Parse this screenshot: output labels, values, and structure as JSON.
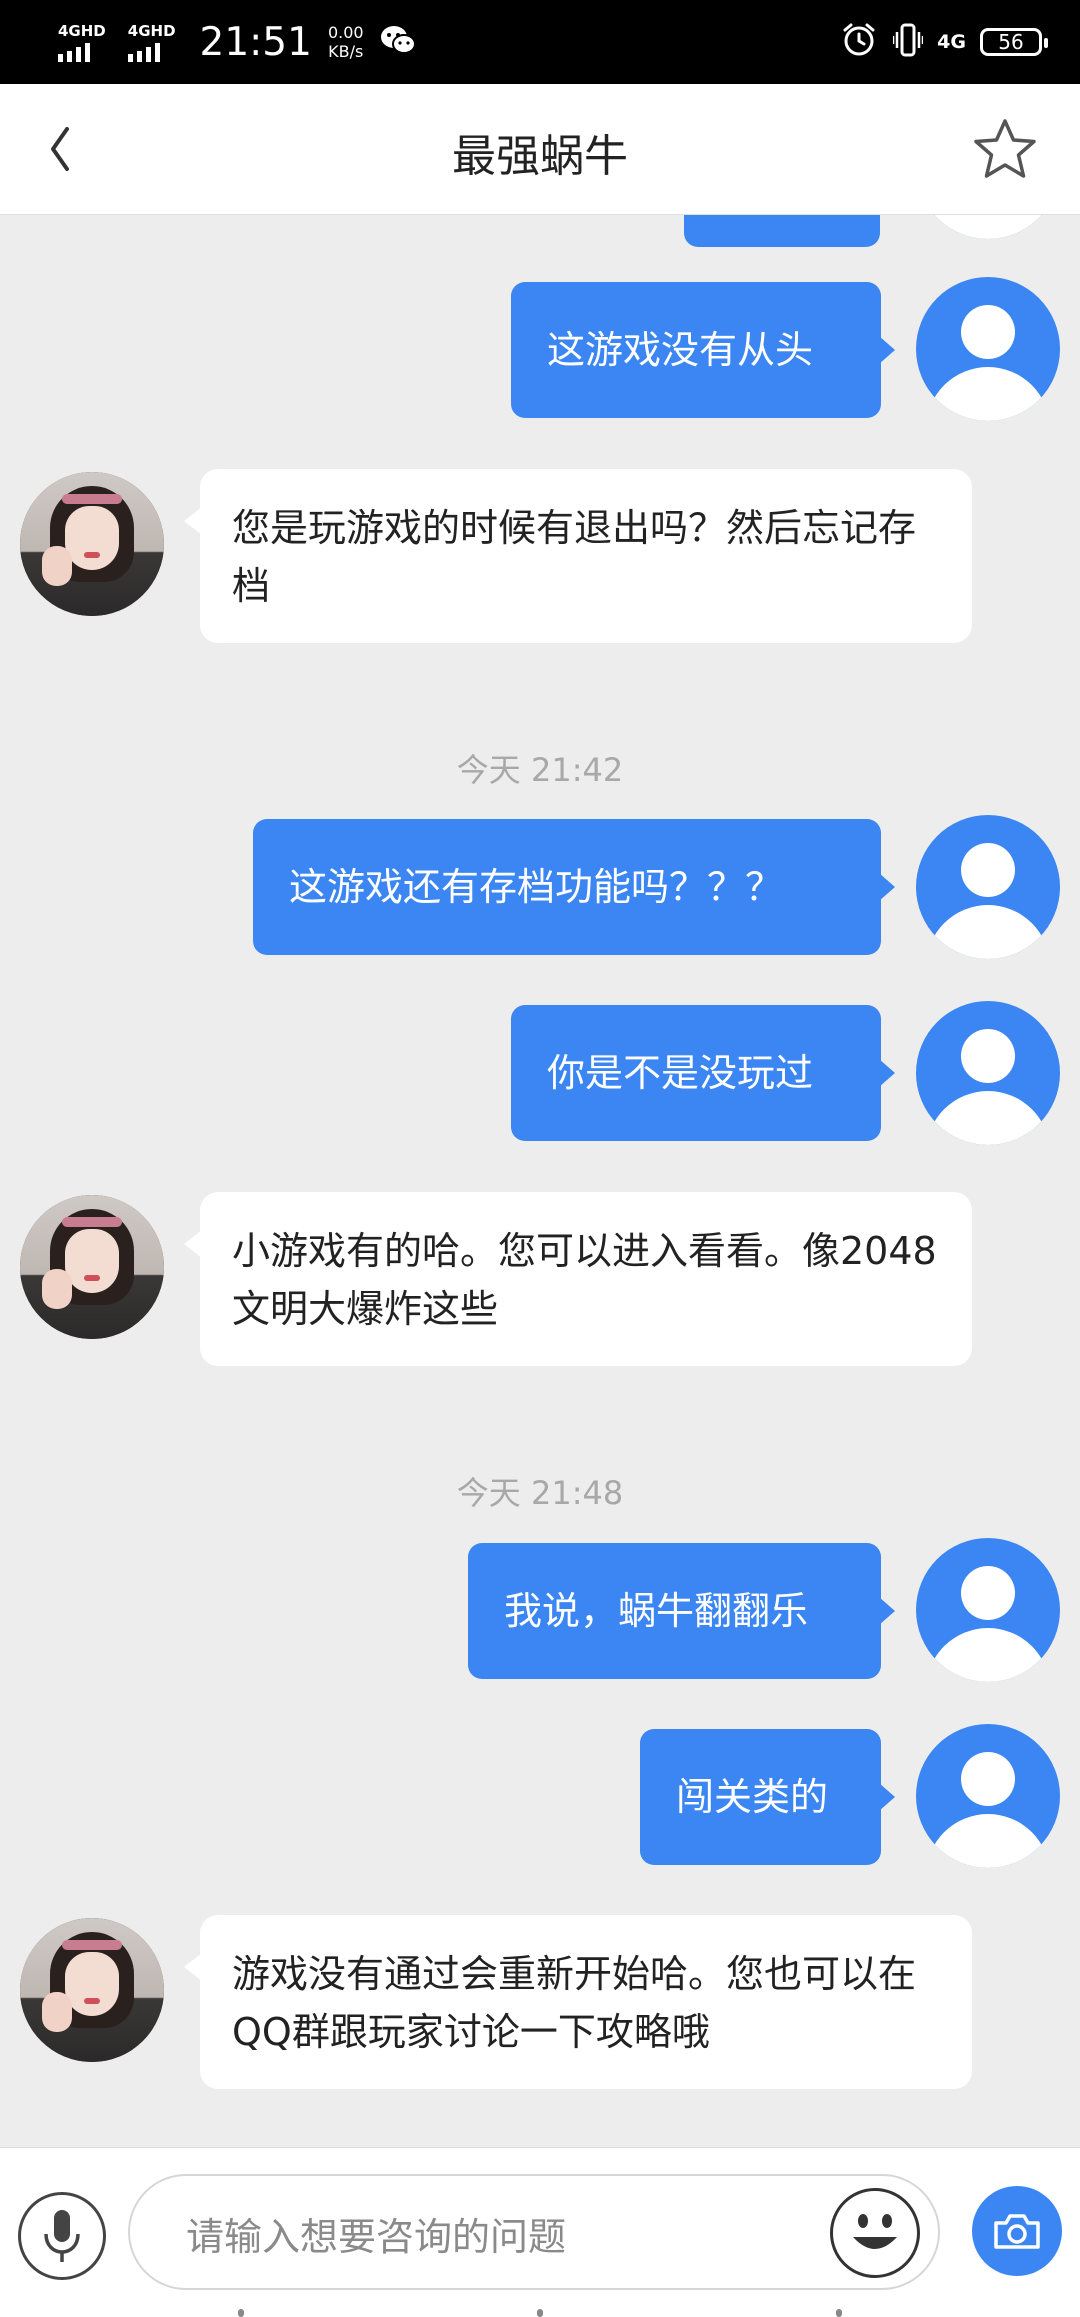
{
  "status_bar": {
    "sim1_label": "4GHD",
    "sim2_label": "4GHD",
    "time": "21:51",
    "speed_value": "0.00",
    "speed_unit": "KB/s",
    "network": "4G",
    "battery": "56",
    "icons": [
      "wechat-icon",
      "alarm-icon",
      "vibrate-icon",
      "battery-icon"
    ]
  },
  "header": {
    "title": "最强蜗牛",
    "back_icon": "chevron-left-icon",
    "favorite_icon": "star-outline-icon"
  },
  "messages": [
    {
      "from": "user",
      "text": "这游戏没有从头"
    },
    {
      "from": "agent",
      "text": "您是玩游戏的时候有退出吗？然后忘记存档"
    },
    {
      "type": "time",
      "text": "今天 21:42"
    },
    {
      "from": "user",
      "text": "这游戏还有存档功能吗？？？"
    },
    {
      "from": "user",
      "text": "你是不是没玩过"
    },
    {
      "from": "agent",
      "text": "小游戏有的哈。您可以进入看看。像2048  文明大爆炸这些"
    },
    {
      "type": "time",
      "text": "今天 21:48"
    },
    {
      "from": "user",
      "text": "我说，蜗牛翻翻乐"
    },
    {
      "from": "user",
      "text": "闯关类的"
    },
    {
      "from": "agent",
      "text": "游戏没有通过会重新开始哈。您也可以在QQ群跟玩家讨论一下攻略哦"
    }
  ],
  "input": {
    "placeholder": "请输入想要咨询的问题",
    "voice_icon": "microphone-icon",
    "emoji_icon": "emoji-icon",
    "camera_icon": "camera-icon"
  },
  "colors": {
    "accent": "#3b86f2",
    "chat_background": "#ededed",
    "timestamp": "#a8a8a8"
  }
}
